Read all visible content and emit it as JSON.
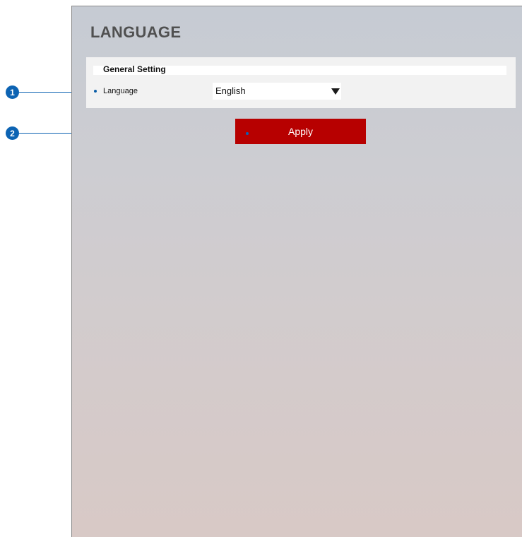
{
  "page": {
    "title": "LANGUAGE"
  },
  "general_setting": {
    "header": "General Setting",
    "language_label": "Language",
    "language_value": "English",
    "language_icon": "dropdown-arrow-icon"
  },
  "actions": {
    "apply_label": "Apply"
  },
  "callouts": {
    "one": "1",
    "two": "2"
  },
  "colors": {
    "accent_red": "#b70000",
    "callout_blue": "#0c63b3",
    "title_gray": "#505050"
  }
}
